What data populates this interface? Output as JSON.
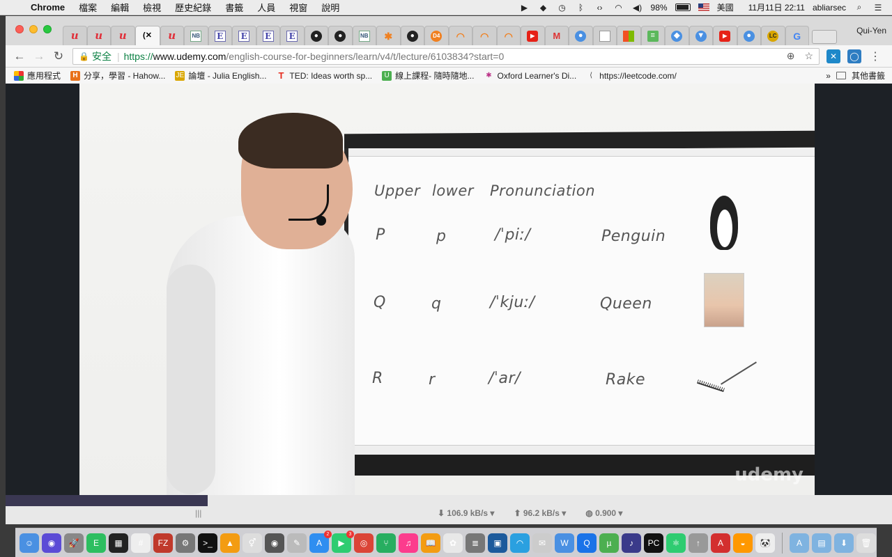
{
  "menubar": {
    "app": "Chrome",
    "items": [
      "檔案",
      "編輯",
      "檢視",
      "歷史紀錄",
      "書籤",
      "人員",
      "視窗",
      "說明"
    ],
    "battery": "98%",
    "input_source": "美國",
    "datetime": "11月11日  22:11",
    "user": "abliarsec"
  },
  "browser": {
    "profile": "Qui-Yen",
    "tabs": [
      {
        "icon": "udemy-icon",
        "glyph": "u"
      },
      {
        "icon": "udemy-icon",
        "glyph": "u"
      },
      {
        "icon": "udemy-icon",
        "glyph": "u"
      },
      {
        "icon": "close-icon",
        "glyph": "(✕",
        "active": true
      },
      {
        "icon": "udemy-icon",
        "glyph": "u"
      },
      {
        "icon": "notebook-icon",
        "glyph": "NB"
      },
      {
        "icon": "e-icon",
        "glyph": "E"
      },
      {
        "icon": "e-icon",
        "glyph": "E"
      },
      {
        "icon": "e-icon",
        "glyph": "E"
      },
      {
        "icon": "e-icon",
        "glyph": "E"
      },
      {
        "icon": "github-icon",
        "glyph": "●"
      },
      {
        "icon": "github-icon",
        "glyph": "●"
      },
      {
        "icon": "notebook-icon",
        "glyph": "NB"
      },
      {
        "icon": "puzzle-icon",
        "glyph": "✱"
      },
      {
        "icon": "github-icon",
        "glyph": "●"
      },
      {
        "icon": "d4-icon",
        "glyph": "D4"
      },
      {
        "icon": "orange-arc-icon",
        "glyph": "◠"
      },
      {
        "icon": "orange-arc-icon",
        "glyph": "◠"
      },
      {
        "icon": "orange-arc-icon",
        "glyph": "◠"
      },
      {
        "icon": "youtube-icon",
        "glyph": "▶"
      },
      {
        "icon": "gmail-icon",
        "glyph": "M"
      },
      {
        "icon": "blue-circle-icon",
        "glyph": "●"
      },
      {
        "icon": "doc-icon",
        "glyph": ""
      },
      {
        "icon": "microsoft-icon",
        "glyph": ""
      },
      {
        "icon": "sheet-icon",
        "glyph": "≡"
      },
      {
        "icon": "diamond-icon",
        "glyph": "◆"
      },
      {
        "icon": "filter-icon",
        "glyph": "▼"
      },
      {
        "icon": "youtube-icon",
        "glyph": "▶"
      },
      {
        "icon": "blue-circle-icon",
        "glyph": "●"
      },
      {
        "icon": "leetcode-icon",
        "glyph": "LC"
      },
      {
        "icon": "google-icon",
        "glyph": "G"
      }
    ],
    "omnibox": {
      "secure_label": "安全",
      "scheme": "https://",
      "host": "www.udemy.com",
      "path": "/english-course-for-beginners/learn/v4/t/lecture/6103834?start=0"
    },
    "bookmarks": [
      {
        "icon": "apps-icon",
        "label": "應用程式"
      },
      {
        "icon": "hahow-icon",
        "label": "分享，學習 - Hahow..."
      },
      {
        "icon": "julia-icon",
        "label": "論壇 - Julia English..."
      },
      {
        "icon": "ted-icon",
        "label": "TED: Ideas worth sp..."
      },
      {
        "icon": "u-icon",
        "label": "線上課程- 隨時隨地..."
      },
      {
        "icon": "oxford-icon",
        "label": "Oxford Learner's Di..."
      },
      {
        "icon": "leetcode-icon",
        "label": "https://leetcode.com/"
      }
    ],
    "other_bookmarks": "其他書籤"
  },
  "slide": {
    "headers": [
      "Upper",
      "lower",
      "Pronunciation"
    ],
    "rows": [
      {
        "upper": "P",
        "lower": "p",
        "pron": "/ˈpiː/",
        "word": "Penguin"
      },
      {
        "upper": "Q",
        "lower": "q",
        "pron": "/ˈkjuː/",
        "word": "Queen"
      },
      {
        "upper": "R",
        "lower": "r",
        "pron": "/ˈar/",
        "word": "Rake"
      }
    ],
    "watermark": "udemy"
  },
  "status": {
    "download": "⬇ 106.9 kB/s ▾",
    "upload": "⬆ 96.2 kB/s ▾",
    "ratio": "◍ 0.900 ▾"
  },
  "dock": [
    {
      "name": "finder-icon",
      "color": "#4a90e2",
      "glyph": "☺"
    },
    {
      "name": "siri-icon",
      "color": "#5b4bd6",
      "glyph": "◉"
    },
    {
      "name": "launchpad-icon",
      "color": "#888",
      "glyph": "🚀"
    },
    {
      "name": "evernote-icon",
      "color": "#2dbe60",
      "glyph": "E"
    },
    {
      "name": "activity-icon",
      "color": "#222",
      "glyph": "▦"
    },
    {
      "name": "slack-icon",
      "color": "#eee",
      "glyph": "#"
    },
    {
      "name": "filezilla-icon",
      "color": "#c0392b",
      "glyph": "FZ"
    },
    {
      "name": "system-prefs-icon",
      "color": "#777",
      "glyph": "⚙"
    },
    {
      "name": "terminal-icon",
      "color": "#111",
      "glyph": ">_"
    },
    {
      "name": "vlc-icon",
      "color": "#f39c12",
      "glyph": "▲"
    },
    {
      "name": "gender-icon",
      "color": "#ddd",
      "glyph": "⚥"
    },
    {
      "name": "camera-icon",
      "color": "#555",
      "glyph": "◉"
    },
    {
      "name": "script-icon",
      "color": "#bbb",
      "glyph": "✎"
    },
    {
      "name": "appstore-icon",
      "color": "#2f8ef0",
      "glyph": "A",
      "badge": "2"
    },
    {
      "name": "facetime-icon",
      "color": "#2ecc71",
      "glyph": "▶",
      "badge": "3"
    },
    {
      "name": "chrome-icon",
      "color": "#db4437",
      "glyph": "◎"
    },
    {
      "name": "tree-icon",
      "color": "#27ae60",
      "glyph": "⑂"
    },
    {
      "name": "itunes-icon",
      "color": "#fc3c8d",
      "glyph": "♫"
    },
    {
      "name": "books-icon",
      "color": "#f39c12",
      "glyph": "📖"
    },
    {
      "name": "photos-icon",
      "color": "#e8e8e8",
      "glyph": "✿"
    },
    {
      "name": "database-icon",
      "color": "#777",
      "glyph": "≣"
    },
    {
      "name": "virtualbox-icon",
      "color": "#1c5a9c",
      "glyph": "▣"
    },
    {
      "name": "wifi-icon",
      "color": "#2aa0e0",
      "glyph": "◠"
    },
    {
      "name": "preview-icon",
      "color": "#ccc",
      "glyph": "✉"
    },
    {
      "name": "word-icon",
      "color": "#4a90e2",
      "glyph": "W"
    },
    {
      "name": "quicktime-icon",
      "color": "#1a73e8",
      "glyph": "Q"
    },
    {
      "name": "utorrent-icon",
      "color": "#4caf50",
      "glyph": "µ"
    },
    {
      "name": "audio-icon",
      "color": "#3a3a8a",
      "glyph": "♪"
    },
    {
      "name": "pycharm-icon",
      "color": "#111",
      "glyph": "PC"
    },
    {
      "name": "atom-icon",
      "color": "#2ecc71",
      "glyph": "⚛"
    },
    {
      "name": "rocket-icon",
      "color": "#999",
      "glyph": "↑"
    },
    {
      "name": "acrobat-icon",
      "color": "#d32f2f",
      "glyph": "A"
    },
    {
      "name": "lantern-icon",
      "color": "#ff9800",
      "glyph": "◒"
    },
    {
      "name": "panda-icon",
      "color": "#eee",
      "glyph": "🐼"
    },
    {
      "name": "folder-apps-icon",
      "color": "#7fb3e0",
      "glyph": "A"
    },
    {
      "name": "folder-docs-icon",
      "color": "#7fb3e0",
      "glyph": "▤"
    },
    {
      "name": "folder-downloads-icon",
      "color": "#7fb3e0",
      "glyph": "⬇"
    },
    {
      "name": "trash-icon",
      "color": "#ddd",
      "glyph": "🗑"
    }
  ]
}
